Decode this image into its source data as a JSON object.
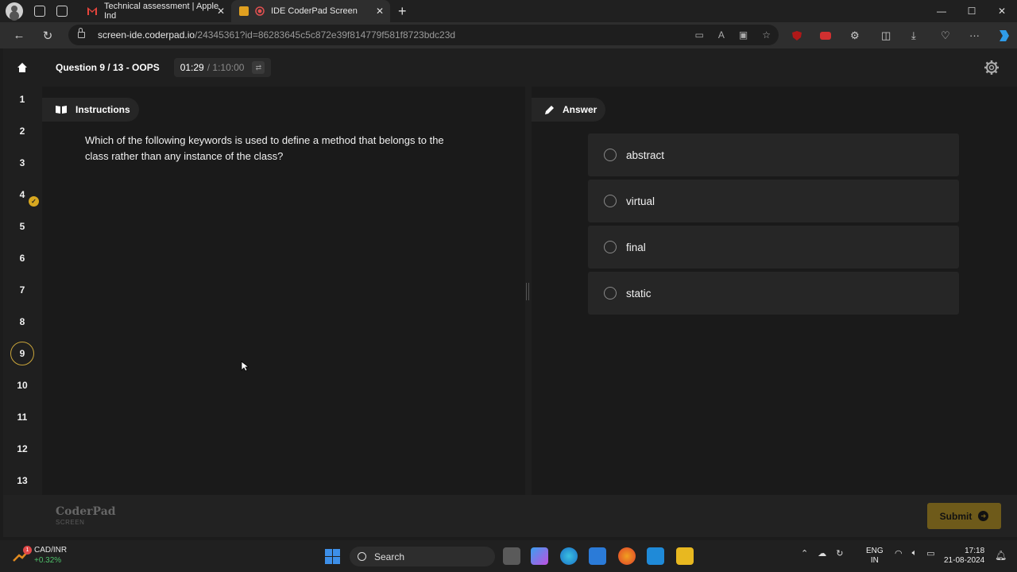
{
  "browser": {
    "tabs": [
      {
        "title": "Technical assessment | Apple Ind"
      },
      {
        "title": "IDE CoderPad Screen"
      }
    ],
    "url_domain": "screen-ide.coderpad.io",
    "url_path": "/24345361?id=86283645c5c872e39f814779f581f8723bdc23d"
  },
  "header": {
    "question_title": "Question 9 / 13 - OOPS",
    "timer_elapsed": "01:29",
    "timer_total": "/ 1:10:00"
  },
  "sidebar": {
    "questions": [
      "1",
      "2",
      "3",
      "4",
      "5",
      "6",
      "7",
      "8",
      "9",
      "10",
      "11",
      "12",
      "13"
    ],
    "current": "9",
    "answered": [
      "4"
    ]
  },
  "instructions": {
    "tab_label": "Instructions",
    "question_text": "Which of the following keywords is used to define a method that belongs to the class rather than any instance of the class?"
  },
  "answer": {
    "tab_label": "Answer",
    "options": [
      "abstract",
      "virtual",
      "final",
      "static"
    ]
  },
  "footer": {
    "brand": "CoderPad",
    "brand_sub": "SCREEN",
    "submit_label": "Submit"
  },
  "taskbar": {
    "ticker_name": "CAD/INR",
    "ticker_change": "+0.32%",
    "ticker_badge": "1",
    "search_placeholder": "Search",
    "lang_line1": "ENG",
    "lang_line2": "IN",
    "time": "17:18",
    "date": "21-08-2024"
  },
  "colors": {
    "accent": "#c8a43a",
    "submit_bg": "#6e5a1a",
    "check_badge": "#d8a820"
  }
}
